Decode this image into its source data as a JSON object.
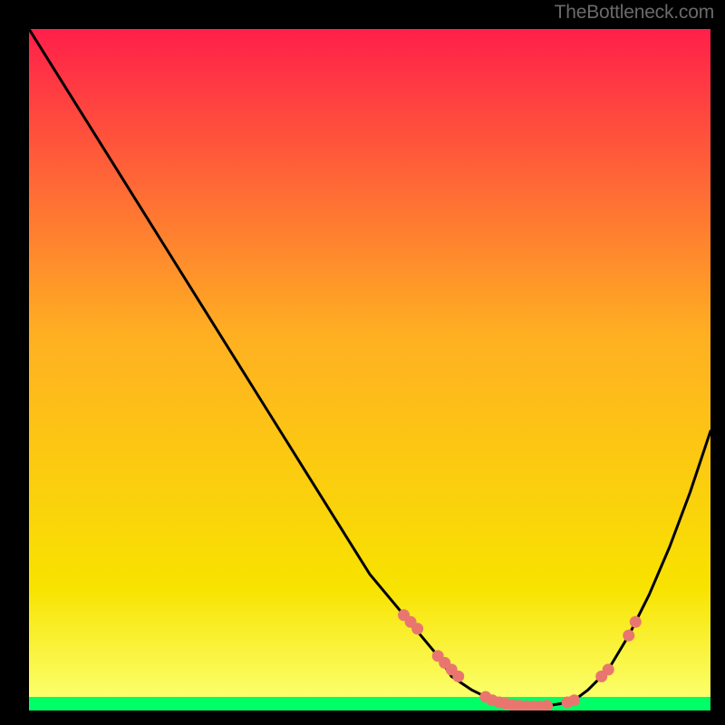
{
  "watermark": "TheBottleneck.com",
  "colors": {
    "red": "#ff1f4a",
    "orange": "#ffb022",
    "yellow_top": "#f8e300",
    "yellow_bottom": "#fbff6b",
    "green": "#00ff66",
    "curve": "#000000",
    "marker": "#e9766e"
  },
  "chart_data": {
    "type": "line",
    "title": "",
    "xlabel": "",
    "ylabel": "",
    "xlim": [
      0,
      100
    ],
    "ylim": [
      0,
      100
    ],
    "curve": {
      "x": [
        0,
        5,
        10,
        15,
        20,
        25,
        30,
        35,
        40,
        45,
        50,
        55,
        60,
        62,
        65,
        68,
        70,
        72,
        74,
        76,
        78,
        80,
        82,
        85,
        88,
        91,
        94,
        97,
        100
      ],
      "y": [
        100,
        92,
        84,
        76,
        68,
        60,
        52,
        44,
        36,
        28,
        20,
        14,
        8,
        5,
        3,
        1.5,
        1,
        0.7,
        0.6,
        0.7,
        1,
        1.5,
        3,
        6,
        11,
        17,
        24,
        32,
        41
      ]
    },
    "markers": [
      {
        "x": 55,
        "y": 14
      },
      {
        "x": 56,
        "y": 13
      },
      {
        "x": 57,
        "y": 12
      },
      {
        "x": 60,
        "y": 8
      },
      {
        "x": 61,
        "y": 7
      },
      {
        "x": 62,
        "y": 6
      },
      {
        "x": 63,
        "y": 5
      },
      {
        "x": 67,
        "y": 2
      },
      {
        "x": 68,
        "y": 1.5
      },
      {
        "x": 69,
        "y": 1.2
      },
      {
        "x": 70,
        "y": 1
      },
      {
        "x": 71,
        "y": 0.8
      },
      {
        "x": 72,
        "y": 0.7
      },
      {
        "x": 73,
        "y": 0.6
      },
      {
        "x": 74,
        "y": 0.6
      },
      {
        "x": 75,
        "y": 0.6
      },
      {
        "x": 76,
        "y": 0.7
      },
      {
        "x": 79,
        "y": 1.2
      },
      {
        "x": 80,
        "y": 1.5
      },
      {
        "x": 84,
        "y": 5
      },
      {
        "x": 85,
        "y": 6
      },
      {
        "x": 88,
        "y": 11
      },
      {
        "x": 89,
        "y": 13
      }
    ],
    "green_band": {
      "from": 0,
      "to": 2
    },
    "yellow_band": {
      "from": 2,
      "to": 18
    }
  }
}
